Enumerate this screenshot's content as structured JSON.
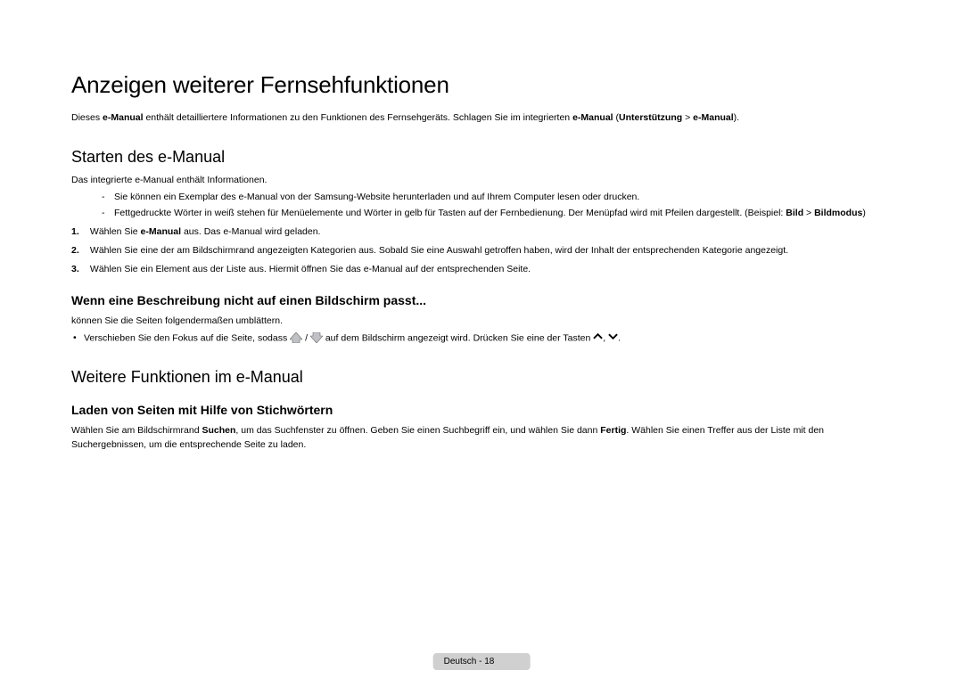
{
  "title": "Anzeigen weiterer Fernsehfunktionen",
  "intro": {
    "pre": "Dieses ",
    "bold1": "e-Manual",
    "mid1": " enthält detailliertere Informationen zu den Funktionen des Fernsehgeräts. Schlagen Sie im integrierten ",
    "bold2": "e-Manual",
    "mid2": " (",
    "bold3": "Unterstützung",
    "mid3": " > ",
    "bold4": "e-Manual",
    "end": ")."
  },
  "section1": {
    "heading": "Starten des e-Manual",
    "p1": "Das integrierte e-Manual enthält Informationen.",
    "dash1": "Sie können ein Exemplar des e-Manual von der Samsung-Website herunterladen und auf Ihrem Computer lesen oder drucken.",
    "dash2_pre": "Fettgedruckte Wörter in weiß stehen für Menüelemente und Wörter in gelb für Tasten auf der Fernbedienung. Der Menüpfad wird mit Pfeilen dargestellt. (Beispiel: ",
    "dash2_b1": "Bild",
    "dash2_mid": " > ",
    "dash2_b2": "Bildmodus",
    "dash2_end": ")",
    "step1_num": "1.",
    "step1_pre": " Wählen Sie ",
    "step1_b": "e-Manual",
    "step1_end": " aus. Das e-Manual wird geladen.",
    "step2_num": "2.",
    "step2": " Wählen Sie eine der am Bildschirmrand angezeigten Kategorien aus. Sobald Sie eine Auswahl getroffen haben, wird der Inhalt der entsprechenden Kategorie angezeigt.",
    "step3_num": "3.",
    "step3": " Wählen Sie ein Element aus der Liste aus. Hiermit öffnen Sie das e-Manual auf der entsprechenden Seite.",
    "sub1_heading": "Wenn eine Beschreibung nicht auf einen Bildschirm passt...",
    "sub1_p": "können Sie die Seiten folgendermaßen umblättern.",
    "bullet_pre": "Verschieben Sie den Fokus auf die Seite, sodass ",
    "bullet_mid1": " / ",
    "bullet_mid2": " auf dem Bildschirm angezeigt wird. Drücken Sie eine der Tasten ",
    "bullet_sep": ", ",
    "bullet_end": "."
  },
  "section2": {
    "heading": "Weitere Funktionen im e-Manual",
    "sub_heading": "Laden von Seiten mit Hilfe von Stichwörtern",
    "p_pre": "Wählen Sie am Bildschirmrand ",
    "p_b1": "Suchen",
    "p_mid1": ", um das Suchfenster zu öffnen. Geben Sie einen Suchbegriff ein, und wählen Sie dann ",
    "p_b2": "Fertig",
    "p_end": ". Wählen Sie einen Treffer aus der Liste mit den Suchergebnissen, um die entsprechende Seite zu laden."
  },
  "footer": "Deutsch - 18"
}
